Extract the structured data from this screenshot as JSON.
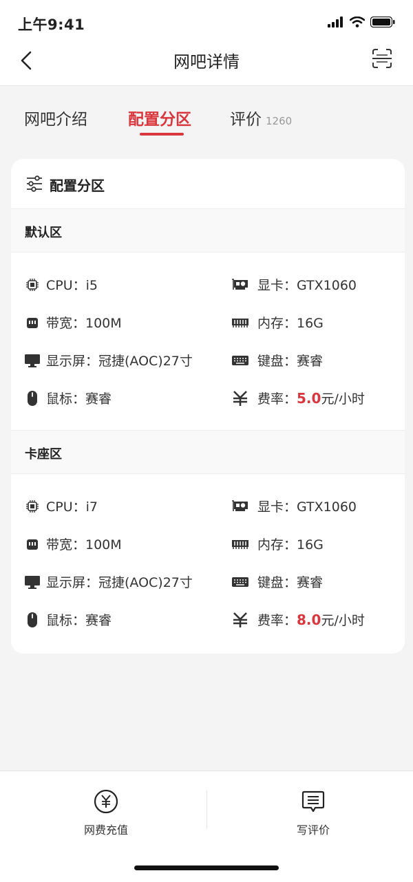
{
  "status": {
    "time": "上午9:41"
  },
  "nav": {
    "title": "网吧详情",
    "back_icon": "chevron-left-icon",
    "scan_icon": "scan-icon"
  },
  "tabs": [
    {
      "label": "网吧介绍"
    },
    {
      "label": "配置分区",
      "active": true
    },
    {
      "label": "评价",
      "count": "1260"
    }
  ],
  "card": {
    "title": "配置分区"
  },
  "zones": [
    {
      "name": "默认区",
      "specs": {
        "cpu": "CPU：i5",
        "gpu": "显卡：GTX1060",
        "bandwidth": "带宽：100M",
        "memory": "内存：16G",
        "monitor": "显示屏：冠捷(AOC)27寸",
        "keyboard": "键盘：赛睿",
        "mouse": "鼠标：赛睿",
        "rate_label": "费率：",
        "rate_value": "5.0",
        "rate_unit": "元/小时"
      }
    },
    {
      "name": "卡座区",
      "specs": {
        "cpu": "CPU：i7",
        "gpu": "显卡：GTX1060",
        "bandwidth": "带宽：100M",
        "memory": "内存：16G",
        "monitor": "显示屏：冠捷(AOC)27寸",
        "keyboard": "键盘：赛睿",
        "mouse": "鼠标：赛睿",
        "rate_label": "费率：",
        "rate_value": "8.0",
        "rate_unit": "元/小时"
      }
    }
  ],
  "bottom": {
    "recharge_label": "网费充值",
    "review_label": "写评价"
  },
  "colors": {
    "accent": "#d9363e"
  }
}
